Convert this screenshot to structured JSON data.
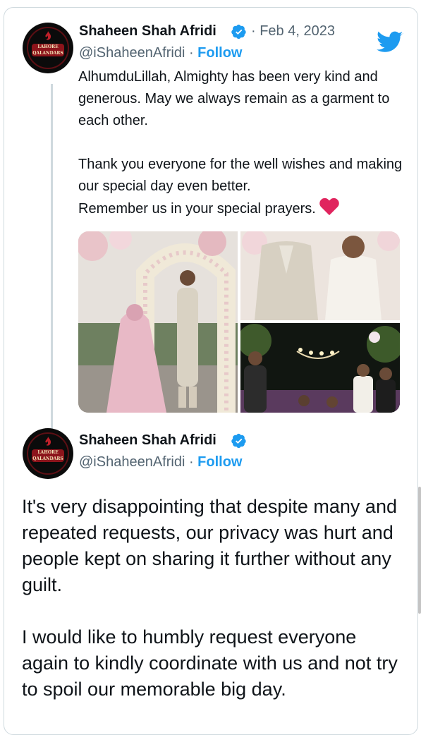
{
  "tweet1": {
    "author_name": "Shaheen Shah Afridi",
    "date_text": "· Feb 4, 2023",
    "handle": "@iShaheenAfridi",
    "handle_sep": " · ",
    "follow_label": "Follow",
    "text": "AlhumduLillah, Almighty has been very kind and generous. May we always remain as a garment to each other.\n\nThank you everyone for the well wishes and making our special day even better.\nRemember us in your special prayers.",
    "emoji": "red-heart",
    "avatar_text": [
      "LAHORE",
      "QALANDARS"
    ],
    "photos": [
      "wedding-archway-photo",
      "groom-portrait-photo",
      "group-evening-photo"
    ]
  },
  "tweet2": {
    "author_name": "Shaheen Shah Afridi",
    "handle": "@iShaheenAfridi",
    "handle_sep": " · ",
    "follow_label": "Follow",
    "text": "It's very disappointing that despite many and repeated requests, our privacy was hurt and people kept on sharing it further without any guilt.\n\nI would like to humbly request everyone again to kindly coordinate with us and not try to spoil our memorable big day."
  },
  "colors": {
    "link": "#1d9bf0",
    "muted": "#536471",
    "text": "#0f1419",
    "heart": "#e0245e"
  }
}
